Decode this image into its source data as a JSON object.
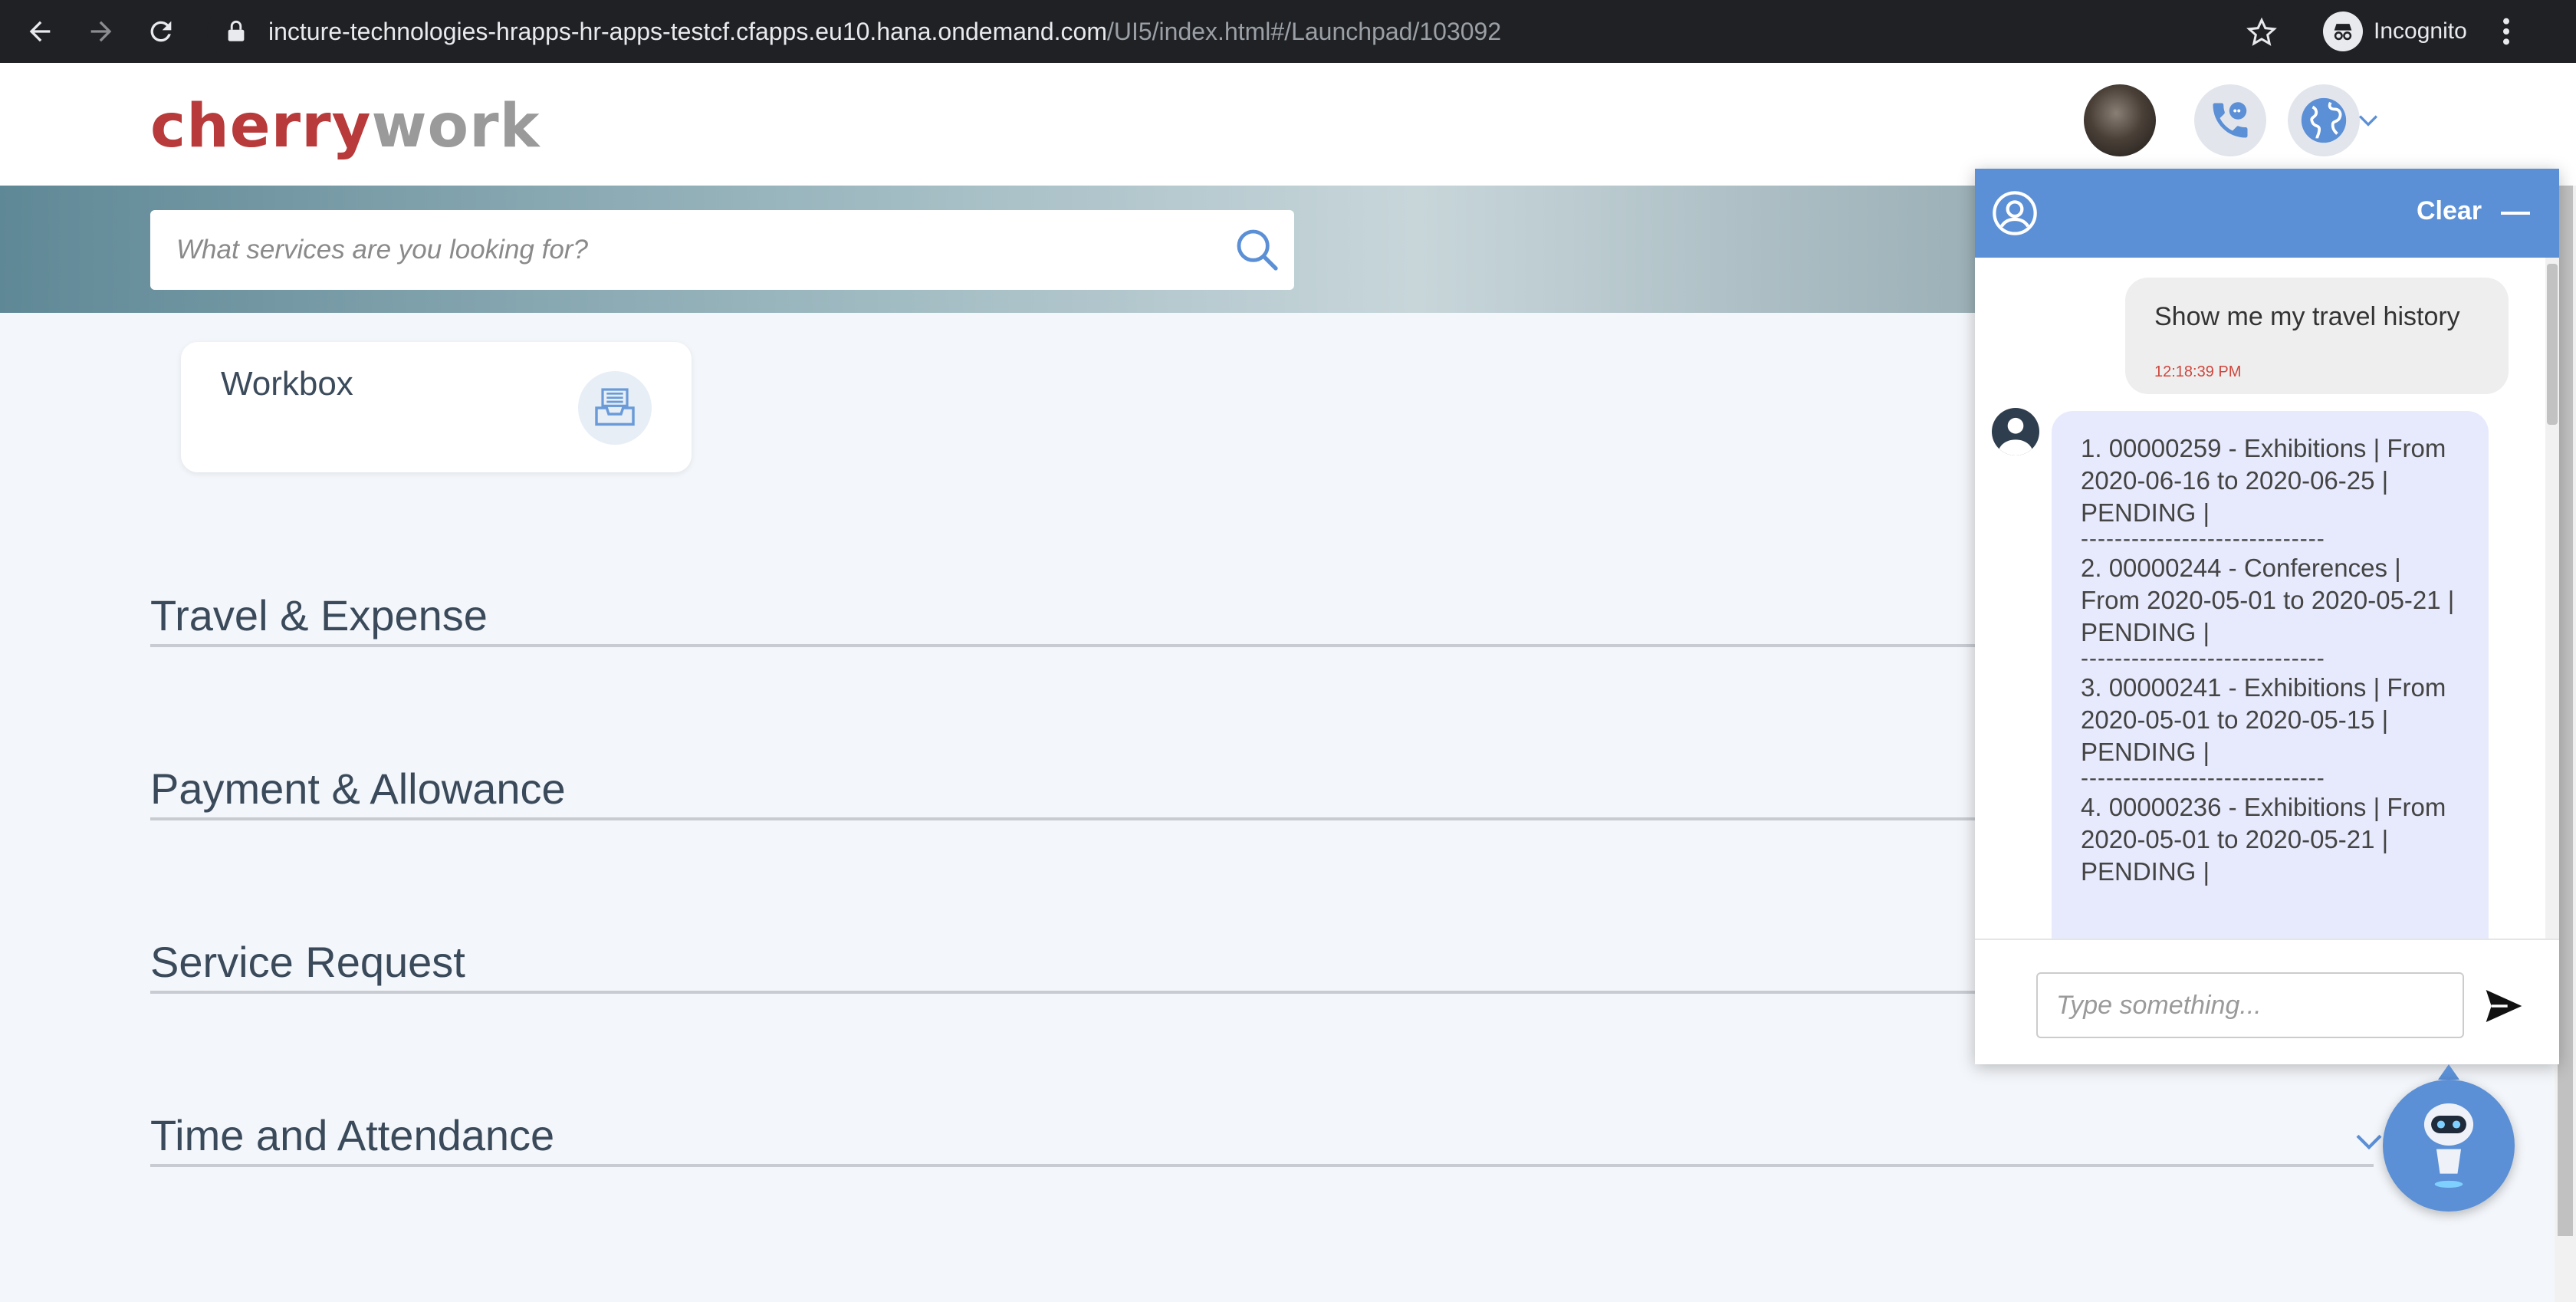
{
  "browser": {
    "url_main": "incture-technologies-hrapps-hr-apps-testcf.cfapps.eu10.hana.ondemand.com",
    "url_path": "/UI5/index.html#/Launchpad/103092",
    "incognito_label": "Incognito"
  },
  "header": {
    "logo_part1": "cherry",
    "logo_part2": "work"
  },
  "search": {
    "placeholder": "What services are you looking for?"
  },
  "workbox": {
    "label": "Workbox"
  },
  "sections": [
    {
      "label": "Travel & Expense"
    },
    {
      "label": "Payment & Allowance"
    },
    {
      "label": "Service Request"
    },
    {
      "label": "Time and Attendance"
    }
  ],
  "chat": {
    "clear_label": "Clear",
    "user_message": "Show me my travel history",
    "user_time": "12:18:39 PM",
    "bot_items": [
      "1. 00000259 - Exhibitions | From 2020-06-16 to 2020-06-25 | PENDING |",
      "2. 00000244 - Conferences | From 2020-05-01 to 2020-05-21 | PENDING |",
      "3. 00000241 - Exhibitions | From 2020-05-01 to 2020-05-15 | PENDING |",
      "4. 00000236 - Exhibitions | From 2020-05-01 to 2020-05-21 | PENDING |"
    ],
    "separator": "-----------------------------",
    "input_placeholder": "Type something..."
  },
  "colors": {
    "chat_accent": "#5b8fd6",
    "bot_bubble": "#e7eafc",
    "logo_red": "#b83a3a"
  }
}
